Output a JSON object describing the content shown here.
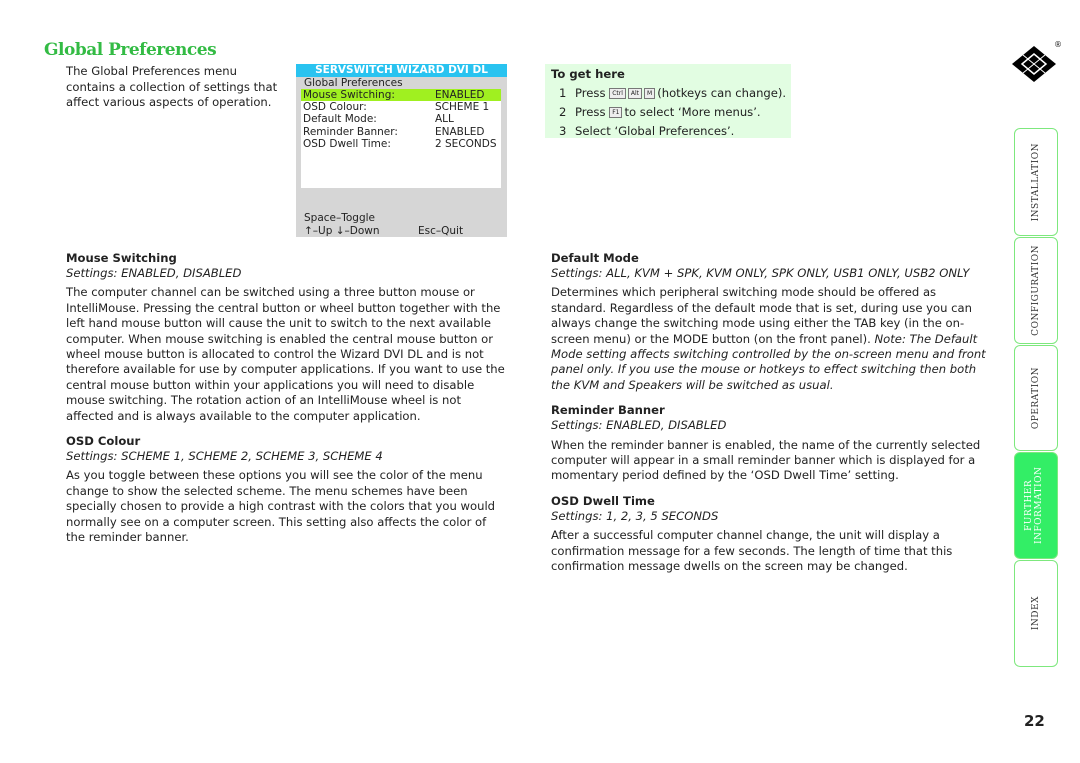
{
  "title": "Global Preferences",
  "intro": "The Global Preferences menu contains a collection of settings that affect various aspects of operation.",
  "osd": {
    "header": "SERVSWITCH WIZARD DVI DL",
    "subtitle": "Global Preferences",
    "rows": [
      {
        "label": "Mouse Switching:",
        "value": "ENABLED",
        "selected": true
      },
      {
        "label": "OSD Colour:",
        "value": "SCHEME 1"
      },
      {
        "label": "Default Mode:",
        "value": "ALL"
      },
      {
        "label": "Reminder Banner:",
        "value": "ENABLED"
      },
      {
        "label": "OSD Dwell Time:",
        "value": "2 SECONDS"
      }
    ],
    "footer": {
      "toggle": "Space–Toggle",
      "updown": "↑–Up ↓–Down",
      "quit": "Esc–Quit"
    },
    "highlight_color": "#a0f020",
    "header_color": "#29c3f0"
  },
  "get_here": {
    "heading": "To get here",
    "step1": {
      "num": "1",
      "pre": "Press",
      "keys": [
        "Ctrl",
        "Alt",
        "M"
      ],
      "post": "(hotkeys can change)."
    },
    "step2": {
      "num": "2",
      "pre": "Press",
      "key": "F1",
      "post": "to select ‘More menus’."
    },
    "step3": {
      "num": "3",
      "text": "Select ‘Global Preferences’."
    }
  },
  "left": {
    "mouse": {
      "heading": "Mouse Switching",
      "settings": "Settings: ENABLED, DISABLED",
      "body": "The computer channel can be switched using a three button mouse or IntelliMouse. Pressing the central button or wheel button together with the left hand mouse button will cause the unit to switch to the next available computer. When mouse switching is enabled the central mouse button or wheel mouse button is allocated to control the Wizard DVI DL and is not therefore available for use by computer applications. If you want to use the central mouse button within your applications you will need to disable mouse switching. The rotation action of an IntelliMouse wheel is not affected and is always available to the computer application."
    },
    "osdcolour": {
      "heading": "OSD Colour",
      "settings": "Settings: SCHEME 1, SCHEME 2, SCHEME 3, SCHEME 4",
      "body": "As you toggle between these options you will see the color of the menu change to show the selected scheme. The menu schemes have been specially chosen to provide a high contrast with the colors that you would normally see on a computer screen. This setting also affects the color of the reminder banner."
    }
  },
  "right": {
    "default": {
      "heading": "Default Mode",
      "settings": "Settings: ALL, KVM + SPK, KVM ONLY, SPK ONLY, USB1 ONLY, USB2 ONLY",
      "body": "Determines which peripheral switching mode should be offered as standard. Regardless of the default mode that is set, during use you can always change the switching mode using either the TAB key (in the on-screen menu) or the MODE button (on the front panel).",
      "note": "Note: The Default Mode setting affects switching controlled by the on-screen menu and front panel only. If you use the mouse or hotkeys to effect switching then both the KVM and Speakers will be switched as usual."
    },
    "reminder": {
      "heading": "Reminder Banner",
      "settings": "Settings: ENABLED, DISABLED",
      "body": "When the reminder banner is enabled, the name of the currently selected computer will appear in a small reminder banner which is displayed for a momentary period defined by the ‘OSD Dwell Time’ setting."
    },
    "dwell": {
      "heading": "OSD Dwell Time",
      "settings": "Settings: 1, 2, 3, 5 SECONDS",
      "body": "After a successful computer channel change, the unit will display a confirmation message for a few seconds. The length of time that this confirmation message dwells on the screen may be changed."
    }
  },
  "tabs": [
    {
      "label": "INSTALLATION"
    },
    {
      "label": "CONFIGURATION"
    },
    {
      "label": "OPERATION"
    },
    {
      "label": "FURTHER INFORMATION",
      "active": true
    },
    {
      "label": "INDEX"
    }
  ],
  "logo": {
    "text": "®"
  },
  "page_number": "22",
  "accent_color": "#33ee66"
}
